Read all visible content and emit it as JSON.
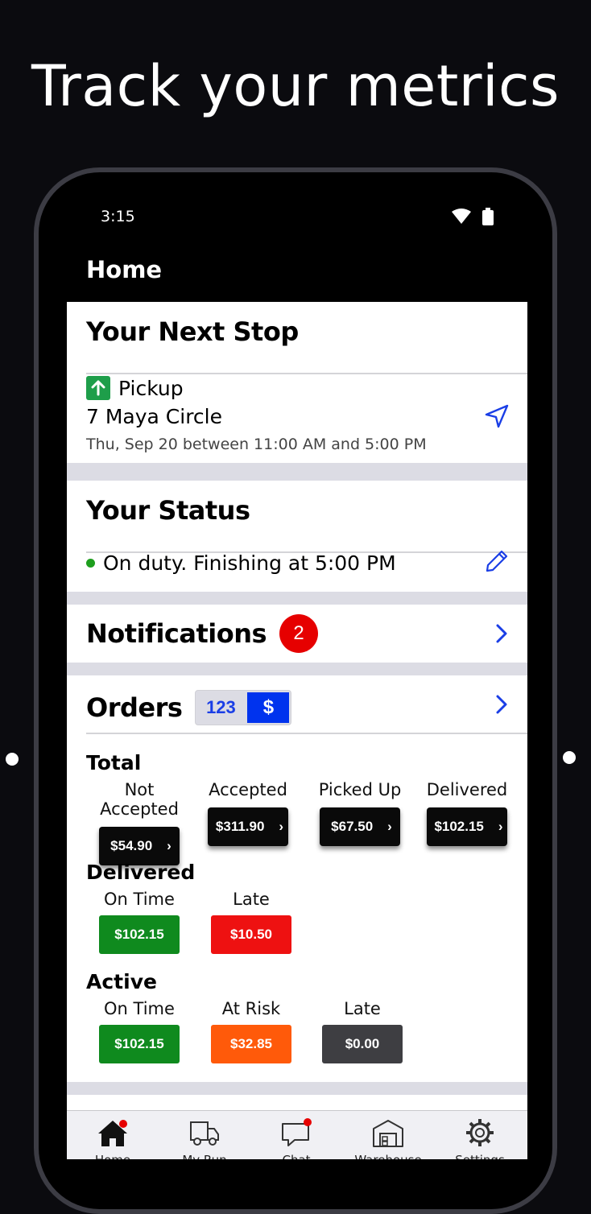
{
  "headline": "Track your metrics",
  "status_bar": {
    "time": "3:15",
    "wifi_icon": "wifi-icon",
    "battery_icon": "battery-icon"
  },
  "app_bar": {
    "title": "Home"
  },
  "next_stop": {
    "title": "Your Next Stop",
    "type_label": "Pickup",
    "address": "7 Maya Circle",
    "window": "Thu, Sep 20 between 11:00 AM and 5:00 PM"
  },
  "status": {
    "title": "Your Status",
    "text": "On duty. Finishing at 5:00 PM",
    "dot_color": "#1e9e1e"
  },
  "notifications": {
    "title": "Notifications",
    "count": "2"
  },
  "orders": {
    "title": "Orders",
    "toggle_count": "123",
    "toggle_money": "$",
    "total": {
      "label": "Total",
      "items": [
        {
          "label": "Not Accepted",
          "value": "$54.90"
        },
        {
          "label": "Accepted",
          "value": "$311.90"
        },
        {
          "label": "Picked Up",
          "value": "$67.50"
        },
        {
          "label": "Delivered",
          "value": "$102.15"
        }
      ]
    },
    "delivered": {
      "label": "Delivered",
      "items": [
        {
          "label": "On Time",
          "value": "$102.15",
          "color": "#0f8a1e"
        },
        {
          "label": "Late",
          "value": "$10.50",
          "color": "#ee1111"
        }
      ]
    },
    "active": {
      "label": "Active",
      "items": [
        {
          "label": "On Time",
          "value": "$102.15",
          "color": "#0f8a1e"
        },
        {
          "label": "At Risk",
          "value": "$32.85",
          "color": "#ff5a0a"
        },
        {
          "label": "Late",
          "value": "$0.00",
          "color": "#3e3e42"
        }
      ]
    }
  },
  "tabs": [
    {
      "label": "Home",
      "icon": "home-icon"
    },
    {
      "label": "My Run",
      "icon": "truck-icon"
    },
    {
      "label": "Chat",
      "icon": "chat-icon"
    },
    {
      "label": "Warehouse",
      "icon": "warehouse-icon"
    },
    {
      "label": "Settings",
      "icon": "gear-icon"
    }
  ],
  "colors": {
    "accent_blue": "#1a3ee6",
    "pickup_green": "#1e9e4a",
    "alert_red": "#e60000"
  }
}
